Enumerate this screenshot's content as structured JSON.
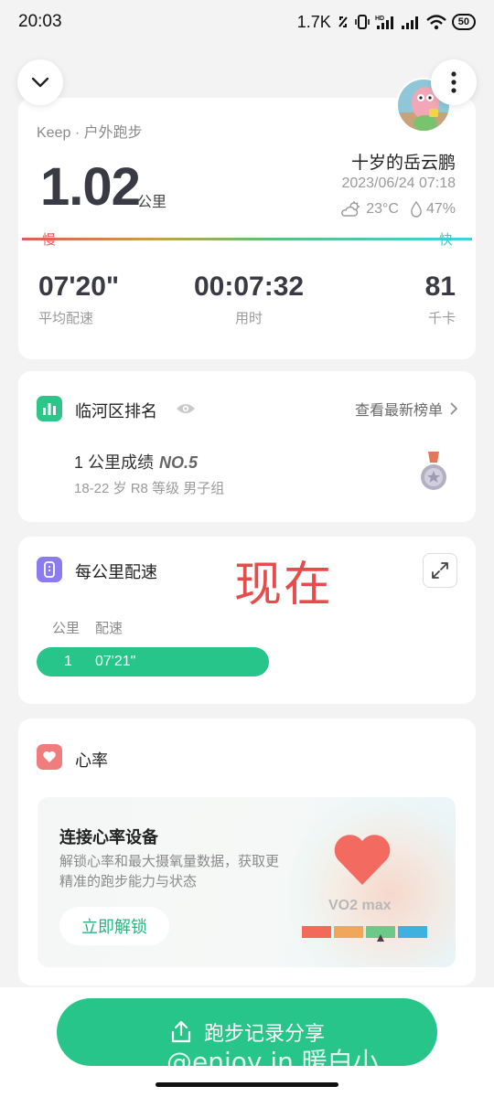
{
  "status_bar": {
    "time": "20:03",
    "speed": "1.7K",
    "battery": "50"
  },
  "summary": {
    "source": "Keep · 户外跑步",
    "distance": "1.02",
    "distance_unit": "公里",
    "user_name": "十岁的岳云鹏",
    "datetime": "2023/06/24 07:18",
    "temperature": "23°C",
    "humidity": "47%",
    "pace_slow_label": "慢",
    "pace_fast_label": "快",
    "stats": [
      {
        "value": "07'20\"",
        "label": "平均配速"
      },
      {
        "value": "00:07:32",
        "label": "用时"
      },
      {
        "value": "81",
        "label": "千卡"
      }
    ]
  },
  "ranking": {
    "title": "临河区排名",
    "view_latest": "查看最新榜单",
    "score_label": "1 公里成绩",
    "rank_no": "NO.5",
    "group": "18-22 岁 R8 等级 男子组"
  },
  "pace_card": {
    "title": "每公里配速",
    "overlay_text": "现在",
    "col_km": "公里",
    "col_pace": "配速",
    "rows": [
      {
        "km": "1",
        "pace": "07'21\""
      }
    ]
  },
  "heart_rate": {
    "title": "心率",
    "connect_title": "连接心率设备",
    "description": "解锁心率和最大摄氧量数据，获取更精准的跑步能力与状态",
    "unlock_label": "立即解锁",
    "vo2_label": "VO2 max",
    "scale_colors": [
      "#f26a5a",
      "#f0a75a",
      "#6cc98a",
      "#3fb0e0",
      "#2a8fd8"
    ]
  },
  "bottom": {
    "share_label": "跑步记录分享",
    "watermark": "@enjoy in 暖白小"
  },
  "colors": {
    "accent": "#27c58a",
    "ranking_icon": "#2ec58a",
    "pace_icon": "#8a7bf0",
    "heart_icon": "#f07d7d"
  }
}
